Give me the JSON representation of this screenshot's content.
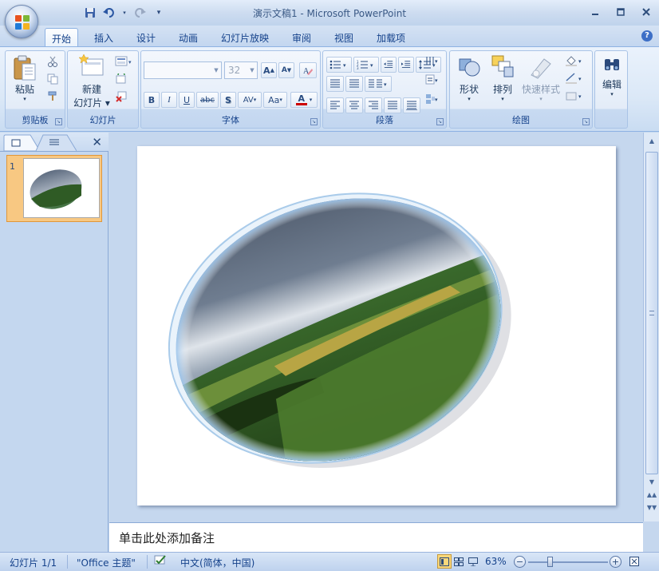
{
  "window": {
    "title": "演示文稿1 - Microsoft PowerPoint"
  },
  "qat": {
    "save_icon": "save-icon",
    "undo_icon": "undo-icon",
    "redo_icon": "redo-icon",
    "customize_icon": "customize-qat-icon"
  },
  "tabs": [
    {
      "label": "开始",
      "active": true
    },
    {
      "label": "插入"
    },
    {
      "label": "设计"
    },
    {
      "label": "动画"
    },
    {
      "label": "幻灯片放映"
    },
    {
      "label": "审阅"
    },
    {
      "label": "视图"
    },
    {
      "label": "加载项"
    }
  ],
  "ribbon": {
    "clipboard": {
      "label": "剪贴板",
      "paste": "粘贴"
    },
    "slides": {
      "label": "幻灯片",
      "new_slide_line1": "新建",
      "new_slide_line2": "幻灯片"
    },
    "font": {
      "label": "字体",
      "font_name": "",
      "font_size": "32",
      "bold": "B",
      "italic": "I",
      "underline": "U",
      "strike": "abc",
      "shadow": "S",
      "spacing": "AV",
      "case": "Aa",
      "grow": "A",
      "shrink": "A",
      "color": "A"
    },
    "paragraph": {
      "label": "段落"
    },
    "drawing": {
      "label": "绘图",
      "shapes": "形状",
      "arrange": "排列",
      "quick_styles": "快速样式"
    },
    "editing": {
      "label": "编辑"
    }
  },
  "notes": {
    "placeholder": "单击此处添加备注"
  },
  "thumbnail": {
    "number": "1"
  },
  "status": {
    "slide": "幻灯片 1/1",
    "theme": "\"Office 主题\"",
    "language": "中文(简体，中国)",
    "zoom": "63%"
  },
  "colors": {
    "accent": "#15428b",
    "selection": "#f8c882"
  }
}
